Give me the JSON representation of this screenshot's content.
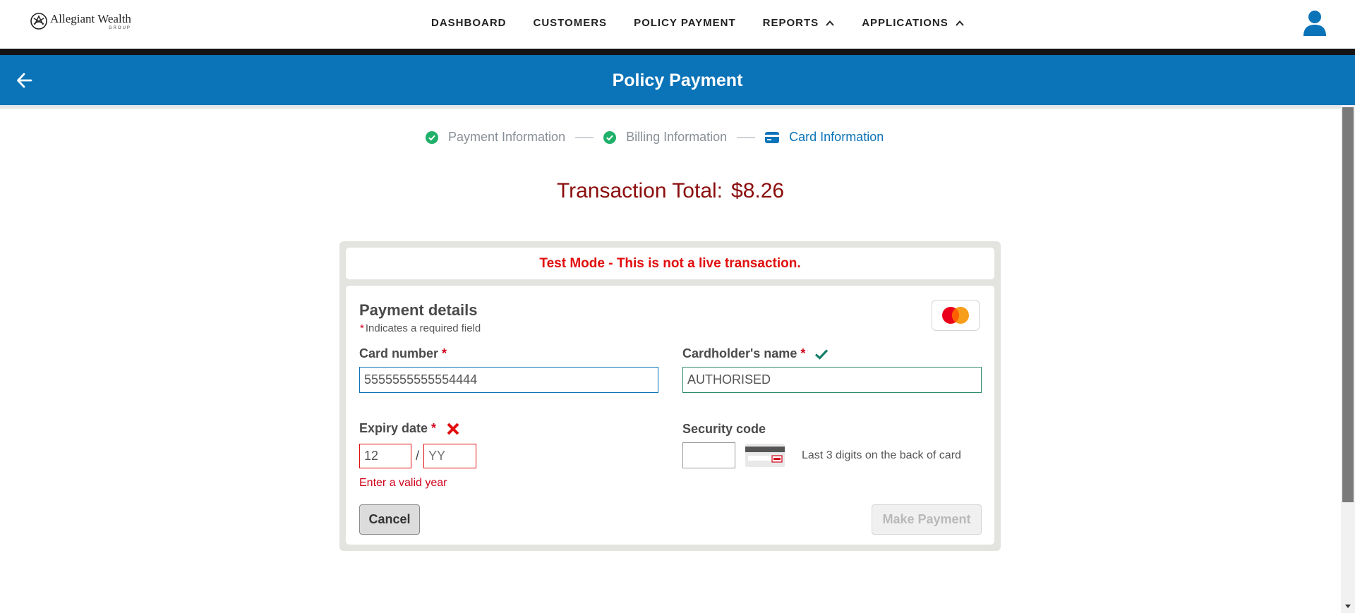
{
  "brand": {
    "name": "Allegiant Wealth",
    "sub": "GROUP"
  },
  "nav": {
    "items": [
      {
        "label": "DASHBOARD"
      },
      {
        "label": "CUSTOMERS"
      },
      {
        "label": "POLICY PAYMENT"
      },
      {
        "label": "REPORTS"
      },
      {
        "label": "APPLICATIONS"
      }
    ]
  },
  "header": {
    "title": "Policy Payment"
  },
  "stepper": {
    "steps": [
      {
        "label": "Payment Information",
        "state": "complete",
        "icon": "check-circle-icon"
      },
      {
        "label": "Billing Information",
        "state": "complete",
        "icon": "check-circle-icon"
      },
      {
        "label": "Card Information",
        "state": "active",
        "icon": "credit-card-icon"
      }
    ]
  },
  "transaction": {
    "label": "Transaction Total:",
    "amount": "$8.26"
  },
  "notice": "Test Mode - This is not a live transaction.",
  "form": {
    "title": "Payment details",
    "required_note": "Indicates a required field",
    "required_marker": "*",
    "card_brand_icon": "mastercard-icon",
    "card_number": {
      "label": "Card number",
      "value": "5555555555554444"
    },
    "cardholder": {
      "label": "Cardholder's name",
      "value": "AUTHORISED"
    },
    "expiry": {
      "label": "Expiry date",
      "month": "12",
      "year_placeholder": "YY",
      "separator": "/",
      "error": "Enter a valid year"
    },
    "security": {
      "label": "Security code",
      "value": "",
      "hint": "Last 3 digits on the back of card"
    },
    "cancel_label": "Cancel",
    "pay_label": "Make Payment"
  },
  "colors": {
    "primary": "#0b73b8",
    "error": "#e10e0e",
    "total": "#8b0d0d",
    "success": "#1fb06a"
  }
}
